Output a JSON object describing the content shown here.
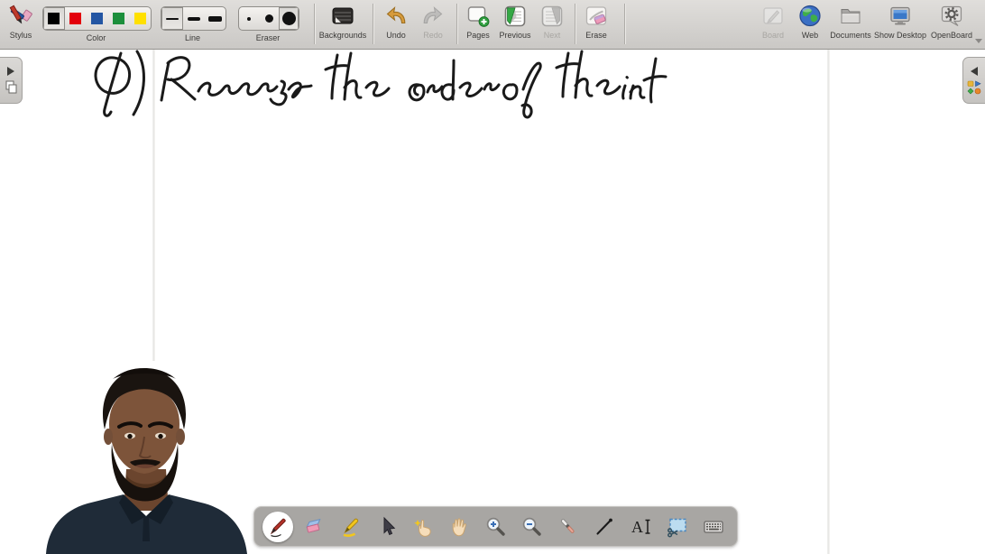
{
  "app": {
    "name_label": "OpenBoard"
  },
  "toolbar": {
    "stylus": "Stylus",
    "color": "Color",
    "line": "Line",
    "eraser": "Eraser",
    "backgrounds": "Backgrounds",
    "undo": "Undo",
    "redo": "Redo",
    "pages": "Pages",
    "previous": "Previous",
    "next": "Next",
    "erase": "Erase",
    "board": "Board",
    "web": "Web",
    "documents": "Documents",
    "show_desktop": "Show Desktop",
    "openboard": "OpenBoard",
    "color_swatches": [
      "#000000",
      "#e3000b",
      "#2456a3",
      "#1d8f3c",
      "#ffe000"
    ],
    "selected_color_index": 0,
    "selected_line_index": 0,
    "selected_eraser_index": 2,
    "redo_enabled": false,
    "next_enabled": false,
    "board_enabled": false
  },
  "canvas": {
    "handwriting": "Q) Reverse the order of the int",
    "ink_color": "#1a1a1a"
  },
  "bottom_toolbar": {
    "selected_tool": "pen",
    "tools": [
      "pen",
      "eraser",
      "marker",
      "selector",
      "interact",
      "hand",
      "zoom-in",
      "zoom-out",
      "laser-pointer",
      "line",
      "text",
      "capture",
      "keyboard"
    ]
  }
}
